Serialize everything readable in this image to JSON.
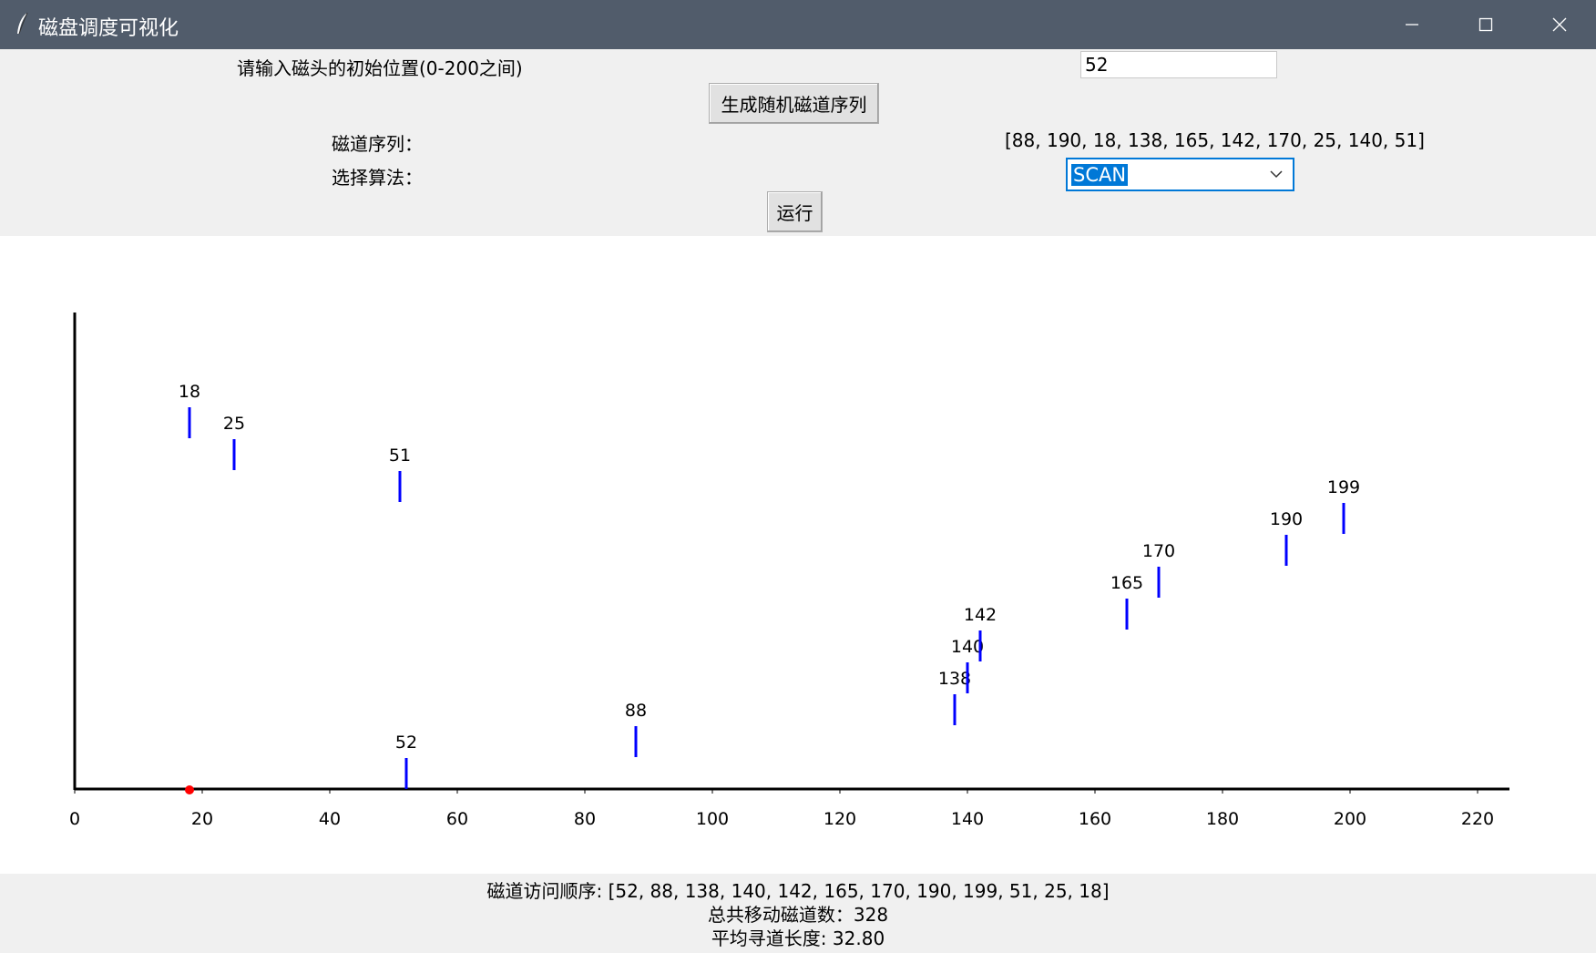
{
  "window": {
    "title": "磁盘调度可视化",
    "icons": {
      "app": "feather-icon",
      "minimize": "minimize-icon",
      "maximize": "maximize-icon",
      "close": "close-icon"
    }
  },
  "form": {
    "initial_label": "请输入磁头的初始位置(0-200之间)",
    "initial_value": "52",
    "generate_button": "生成随机磁道序列",
    "sequence_label": "磁道序列：",
    "sequence_value": "[88, 190, 18, 138, 165, 142, 170, 25, 140, 51]",
    "algorithm_label": "选择算法：",
    "algorithm_selected": "SCAN",
    "run_button": "运行"
  },
  "chart_data": {
    "type": "scatter",
    "x_ticks": [
      0,
      20,
      40,
      60,
      80,
      100,
      120,
      140,
      160,
      180,
      200,
      220
    ],
    "xlim": [
      0,
      225
    ],
    "points": [
      {
        "step": 0,
        "track": 52
      },
      {
        "step": 1,
        "track": 88
      },
      {
        "step": 2,
        "track": 138
      },
      {
        "step": 3,
        "track": 140
      },
      {
        "step": 4,
        "track": 142
      },
      {
        "step": 5,
        "track": 165
      },
      {
        "step": 6,
        "track": 170
      },
      {
        "step": 7,
        "track": 190
      },
      {
        "step": 8,
        "track": 199
      },
      {
        "step": 9,
        "track": 51
      },
      {
        "step": 10,
        "track": 25
      },
      {
        "step": 11,
        "track": 18
      }
    ],
    "head_position": 18,
    "mark_color": "#0000ff",
    "head_color": "#ff0000"
  },
  "results": {
    "order": "磁道访问顺序: [52, 88, 138, 140, 142, 165, 170, 190, 199, 51, 25, 18]",
    "total": "总共移动磁道数：328",
    "average": "平均寻道长度: 32.80"
  }
}
